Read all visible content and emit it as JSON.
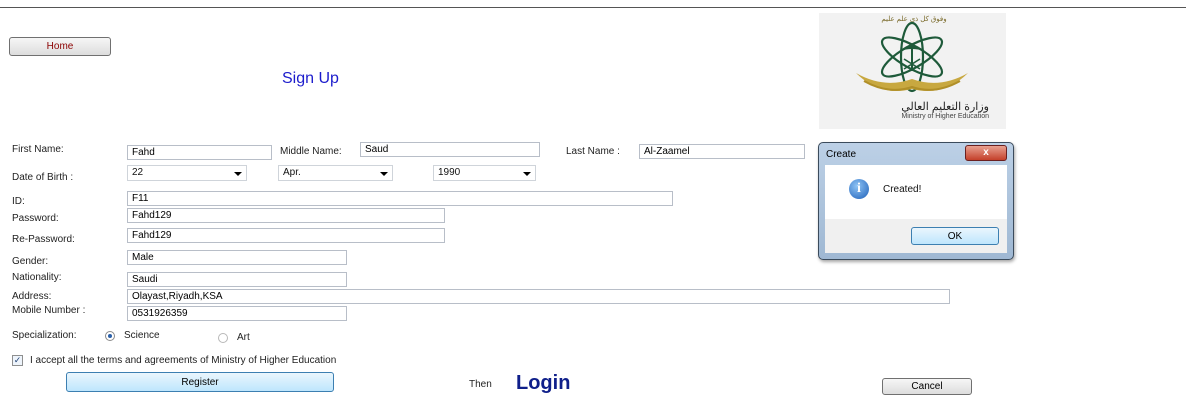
{
  "home_button": "Home",
  "page_title": "Sign Up",
  "logo": {
    "arabic_motto": "وفوق كل ذي علم عليم",
    "arabic_name": "وزارة التعليم العالي",
    "english_name": "Ministry of Higher Education"
  },
  "form": {
    "first_name_label": "First Name:",
    "first_name_value": "Fahd",
    "middle_name_label": "Middle Name:",
    "middle_name_value": "Saud",
    "last_name_label": "Last Name :",
    "last_name_value": "Al-Zaamel",
    "dob_label": "Date of Birth :",
    "dob_day": "22",
    "dob_month": "Apr.",
    "dob_year": "1990",
    "id_label": "ID:",
    "id_value": "F11",
    "password_label": "Password:",
    "password_value": "Fahd129",
    "repassword_label": "Re-Password:",
    "repassword_value": "Fahd129",
    "gender_label": "Gender:",
    "gender_value": "Male",
    "nationality_label": "Nationality:",
    "nationality_value": "Saudi",
    "address_label": "Address:",
    "address_value": "Olayast,Riyadh,KSA",
    "mobile_label": "Mobile Number :",
    "mobile_value": "0531926359",
    "specialization_label": "Specialization:",
    "spec_science": "Science",
    "spec_art": "Art",
    "terms_label": "I accept all the terms and agreements of Ministry of Higher Education"
  },
  "actions": {
    "register": "Register",
    "then": "Then",
    "login": "Login",
    "cancel": "Cancel"
  },
  "dialog": {
    "title": "Create",
    "close": "x",
    "message": "Created!",
    "ok": "OK"
  }
}
